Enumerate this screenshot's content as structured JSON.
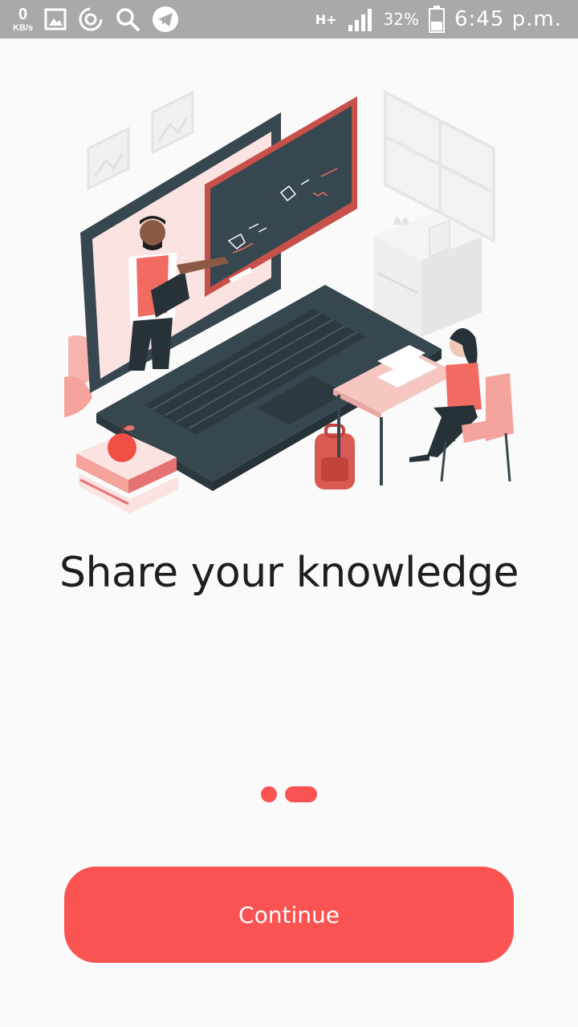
{
  "status_bar": {
    "net_speed_value": "0",
    "net_speed_unit": "KB/s",
    "network_type": "H+",
    "battery_percent": "32%",
    "time": "6:45 p.m.",
    "icons": [
      "gallery-icon",
      "sync-icon",
      "search-icon",
      "telegram-icon",
      "signal-icon",
      "battery-icon"
    ]
  },
  "onboarding": {
    "headline": "Share your knowledge",
    "page_indicator": {
      "total": 2,
      "active": 2
    },
    "continue_label": "Continue"
  },
  "colors": {
    "accent": "#fb5252",
    "status_bar": "#a9a9a9",
    "background": "#fafafa",
    "laptop": "#37474f"
  }
}
